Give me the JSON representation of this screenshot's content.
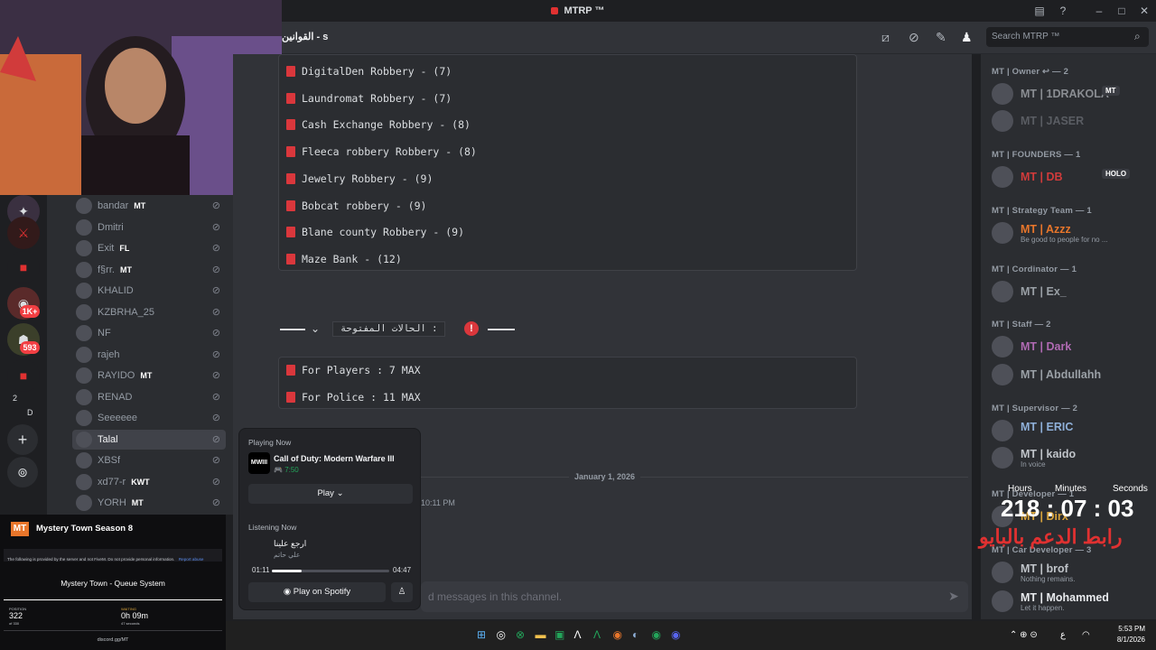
{
  "titlebar": {
    "app_title": "MTRP ™",
    "search_placeholder": "Search MTRP ™",
    "channel_name": "القوانين - s"
  },
  "guilds": {
    "badges": [
      "1K+",
      "593"
    ],
    "counts": [
      "2",
      "D"
    ]
  },
  "voice_members": [
    {
      "name": "bandar",
      "tag": "MT"
    },
    {
      "name": "Dmitri",
      "tag": ""
    },
    {
      "name": "Exit",
      "tag": "FL"
    },
    {
      "name": "f§rr.",
      "tag": "MT"
    },
    {
      "name": "KHALID",
      "tag": ""
    },
    {
      "name": "KZBRHA_25",
      "tag": ""
    },
    {
      "name": "NF",
      "tag": ""
    },
    {
      "name": "rajeh",
      "tag": ""
    },
    {
      "name": "RAYIDO",
      "tag": "MT"
    },
    {
      "name": "RENAD",
      "tag": ""
    },
    {
      "name": "Seeeeee",
      "tag": ""
    },
    {
      "name": "Talal",
      "tag": ""
    },
    {
      "name": "XBSf",
      "tag": ""
    },
    {
      "name": "xd77-r",
      "tag": "KWT"
    },
    {
      "name": "YORH",
      "tag": "MT"
    }
  ],
  "robberies": [
    "DigitalDen Robbery - (7)",
    "Laundromat Robbery - (7)",
    "Cash Exchange Robbery - (8)",
    "Fleeca robbery Robbery - (8)",
    "Jewelry Robbery  - (9)",
    "Bobcat robbery  - (9)",
    "Blane county Robbery - (9)",
    "Maze Bank - (12)"
  ],
  "open_cases": {
    "title": "الحالات المفتوحة  :",
    "rows": [
      "For Players : 7 MAX",
      "For Police : 11 MAX"
    ]
  },
  "divider": {
    "date": "January 1, 2026",
    "time": "10:11 PM"
  },
  "input": {
    "placeholder": "d messages in this channel."
  },
  "popup": {
    "playing_label": "Playing Now",
    "game": "Call of Duty: Modern Warfare III",
    "game_time": "7:50",
    "play_button": "Play",
    "listening_label": "Listening Now",
    "song": "ارجع علينا",
    "artist": "علي حاتم",
    "elapsed": "01:11",
    "duration": "04:47",
    "progress": 0.25,
    "spotify_button": "Play on Spotify"
  },
  "members": {
    "owner_header": "MT | Owner ↩ — 2",
    "owner": [
      {
        "name": "MT | 1DRAKOLA",
        "tag": "MT",
        "color": "#8a8d92"
      },
      {
        "name": "MT | JASER",
        "tag": "",
        "color": "#5a5d63"
      }
    ],
    "founders_header": "MT | FOUNDERS — 1",
    "founders": [
      {
        "name": "MT | DB",
        "tag": "HOLO",
        "color": "#d13b3b"
      }
    ],
    "strategy_header": "MT | Strategy Team — 1",
    "strategy": [
      {
        "name": "MT | Azzz",
        "status": "Be good to people for no ...",
        "color": "#e8762b"
      }
    ],
    "coordinator_header": "MT | Cordinator — 1",
    "coordinator": [
      {
        "name": "MT | Ex_",
        "color": "#9aa0a6"
      }
    ],
    "staff_header": "MT | Staff — 2",
    "staff": [
      {
        "name": "MT | Dark",
        "color": "#b06ab3"
      },
      {
        "name": "MT | Abdullahh",
        "color": "#9aa0a6"
      }
    ],
    "supervisor_header": "MT | Supervisor — 2",
    "supervisor": [
      {
        "name": "MT | ERIC",
        "status": "",
        "color": "#8fb0d9"
      },
      {
        "name": "MT | kaido",
        "status": "In voice",
        "color": "#c0c4c9"
      }
    ],
    "developer_header": "MT | Developer — 1",
    "developer": [
      {
        "name": "MT | Dirx",
        "color": "#d8a33a"
      }
    ],
    "cardev_header": "MT | Car Developer — 3",
    "cardev": [
      {
        "name": "MT | brof",
        "status": "Nothing remains.",
        "color": "#c0c4c9"
      },
      {
        "name": "MT | Mohammed",
        "status": "Let it happen.",
        "color": "#e8eaed"
      }
    ]
  },
  "timer": {
    "labels": [
      "Hours",
      "Minutes",
      "Seconds"
    ],
    "value": "218 : 07 : 03",
    "overlay": "رابط الدعم بالبايو"
  },
  "queue": {
    "title": "Mystery Town Season 8",
    "notice": "The following is provided by the server and not FiveM. Do not provide personal information.",
    "report": "Report abuse",
    "system": "Mystery Town - Queue System",
    "position_label": "POSITION",
    "position": "322",
    "position_total": "of 330",
    "waiting_label": "WAITING",
    "waiting": "0h 09m",
    "waiting_sub": "47 seconds",
    "link": "discord.gg/MT"
  },
  "taskbar": {
    "time": "5:53 PM",
    "date": "8/1/2026",
    "lang": "ع"
  }
}
